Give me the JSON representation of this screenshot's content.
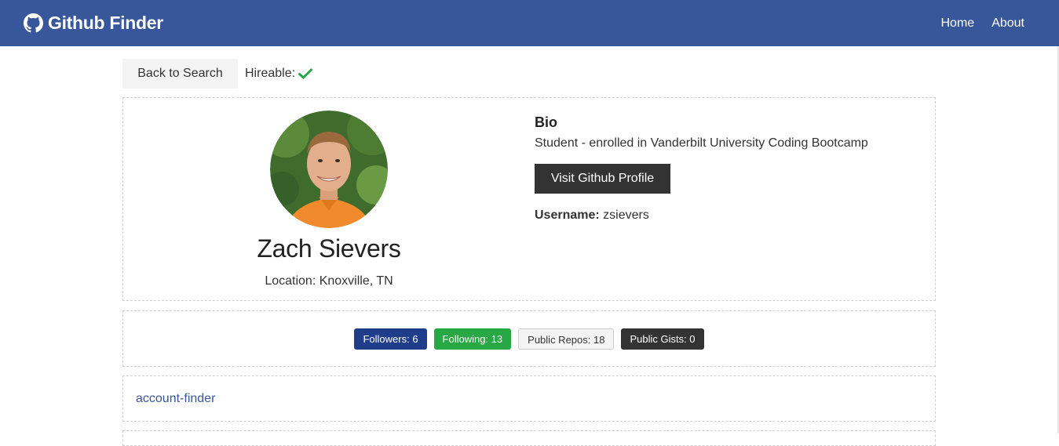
{
  "navbar": {
    "brand_icon": "github-icon",
    "title": "Github Finder",
    "links": [
      {
        "label": "Home"
      },
      {
        "label": "About"
      }
    ],
    "background": "#37579a"
  },
  "toolbar": {
    "back_label": "Back to Search",
    "hireable_label": "Hireable:",
    "hireable_icon": "check-icon",
    "hireable_color": "#28a745"
  },
  "profile": {
    "name": "Zach Sievers",
    "location": "Location: Knoxville, TN",
    "bio_heading": "Bio",
    "bio_text": "Student - enrolled in Vanderbilt University Coding Bootcamp",
    "visit_label": "Visit Github Profile",
    "username_label": "Username:",
    "username_value": "zsievers"
  },
  "stats": {
    "followers": "Followers: 6",
    "following": "Following: 13",
    "public_repos": "Public Repos: 18",
    "public_gists": "Public Gists: 0"
  },
  "repos": [
    {
      "name": "account-finder"
    }
  ]
}
